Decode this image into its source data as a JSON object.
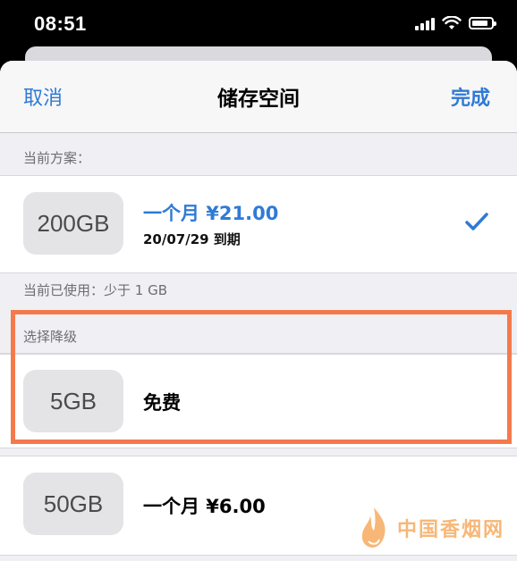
{
  "status_bar": {
    "time": "08:51"
  },
  "nav": {
    "cancel": "取消",
    "title": "储存空间",
    "done": "完成"
  },
  "current_plan": {
    "header": "当前方案：",
    "tile": "200GB",
    "price": "一个月 ¥21.00",
    "expiry": "20/07/29 到期",
    "price_color": "#2f7ad6"
  },
  "usage": "当前已使用：少于 1 GB",
  "downgrade": {
    "header": "选择降级",
    "options": [
      {
        "tile": "5GB",
        "price": "免费"
      },
      {
        "tile": "50GB",
        "price": "一个月 ¥6.00"
      }
    ]
  },
  "highlight_color": "#f47a4c",
  "watermark": "中国香烟网"
}
